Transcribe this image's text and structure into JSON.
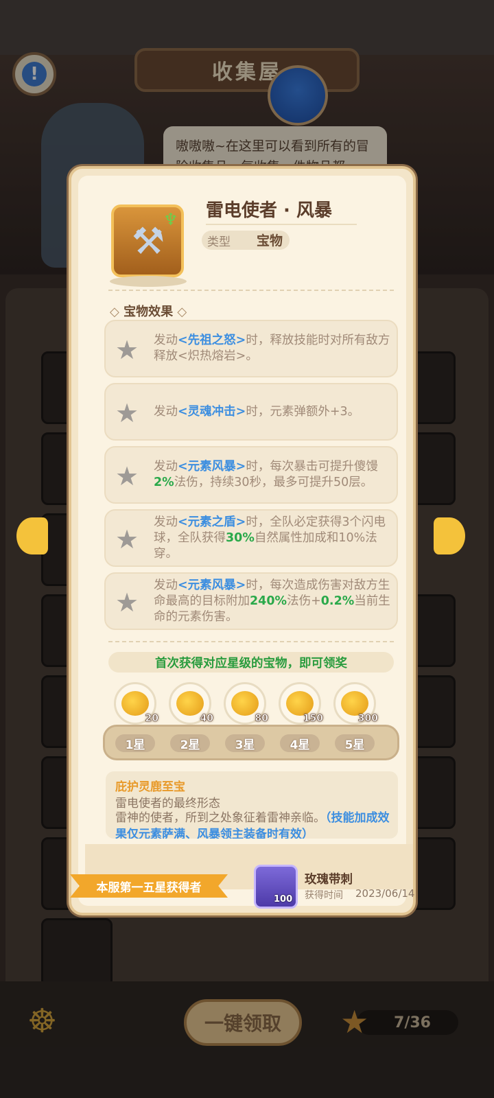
{
  "header": {
    "title": "收集屋"
  },
  "npc": {
    "speech": "嗷嗷嗷~在这里可以看到所有的冒险收集品，每收集一件物品都"
  },
  "item": {
    "name": "雷电使者 · 风暴",
    "type_label": "类型",
    "type_value": "宝物",
    "icon": "hammer-icon",
    "rarity_icon": "antler-icon"
  },
  "effects": {
    "heading": "宝物效果",
    "items": [
      {
        "pre": "发动",
        "skill": "<先祖之怒>",
        "post": "时，释放技能时对所有敌方释放<炽热熔岩>。"
      },
      {
        "pre": "发动",
        "skill": "<灵魂冲击>",
        "post": "时，元素弹额外+3。"
      },
      {
        "pre": "发动",
        "skill": "<元素风暴>",
        "mid": "时，每次暴击可提升傻馒",
        "g1": "2%",
        "post": "法伤，持续30秒，最多可提升50层。"
      },
      {
        "pre": "发动",
        "skill": "<元素之盾>",
        "mid": "时，全队必定获得3个闪电球，全队获得",
        "g1": "30%",
        "post": "自然属性加成和10%法穿。"
      },
      {
        "pre": "发动",
        "skill": "<元素风暴>",
        "mid": "时，每次造成伤害对敌方生命最高的目标附加",
        "g1": "240%",
        "mid2": "法伤+",
        "g2": "0.2%",
        "post": "当前生命的元素伤害。"
      }
    ]
  },
  "rewards": {
    "banner": "首次获得对应星级的宝物，即可领奖",
    "tiers": [
      {
        "amount": "20",
        "label": "1星"
      },
      {
        "amount": "40",
        "label": "2星"
      },
      {
        "amount": "80",
        "label": "3星"
      },
      {
        "amount": "150",
        "label": "4星"
      },
      {
        "amount": "300",
        "label": "5星"
      }
    ]
  },
  "lore": {
    "title": "庇护灵鹿至宝",
    "subtitle": "雷电使者的最终形态",
    "body": "雷神的使者，所到之处象征着雷神亲临。",
    "note": "（技能加成效果仅元素萨满、风暴领主装备时有效）"
  },
  "first": {
    "ribbon": "本服第一五星获得者",
    "player": "玫瑰带刺",
    "level": "100",
    "obtain_label": "获得时间",
    "date": "2023/06/14"
  },
  "bottom": {
    "claim_all": "一键领取",
    "progress": "7/36"
  },
  "colors": {
    "accent_gold": "#f2a72b",
    "skill_blue": "#3c8ee0",
    "value_green": "#2aa94a"
  }
}
